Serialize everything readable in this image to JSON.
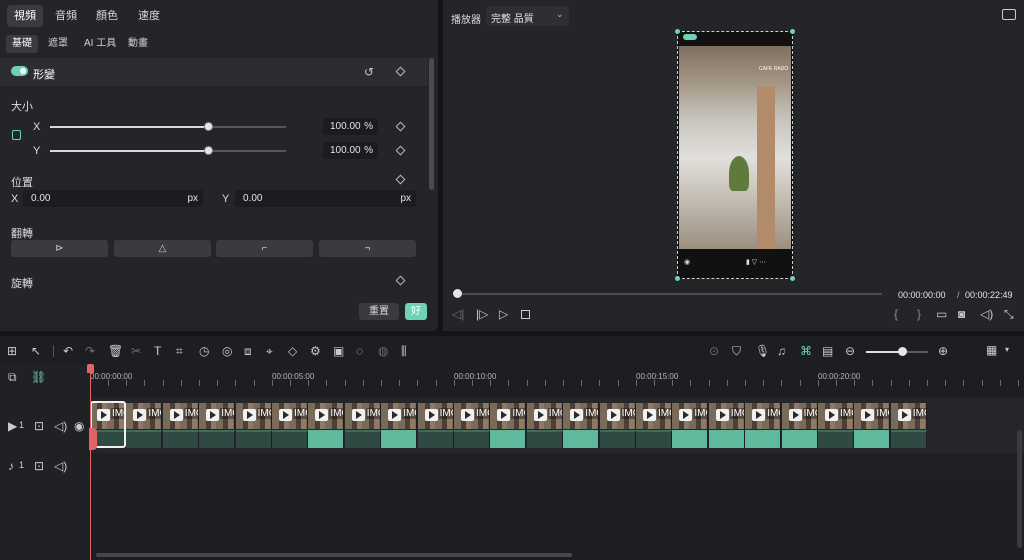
{
  "tabs": [
    "視頻",
    "音頻",
    "顏色",
    "速度"
  ],
  "subtabs": [
    "基礎",
    "遮罩",
    "AI 工具",
    "動畫"
  ],
  "transform": {
    "section": "形變",
    "size_label": "大小",
    "x_label": "X",
    "y_label": "Y",
    "scale_x": "100.00",
    "scale_y": "100.00",
    "unit": "%",
    "scale_x_level": 0.67,
    "scale_y_level": 0.67
  },
  "position": {
    "label": "位置",
    "x_label": "X",
    "x_value": "0.00",
    "y_label": "Y",
    "y_value": "0.00",
    "unit": "px"
  },
  "flip": {
    "label": "翻轉"
  },
  "rotate": {
    "label": "旋轉"
  },
  "buttons": {
    "reset": "重置",
    "ok": "好"
  },
  "player": {
    "label": "播放器",
    "quality": "完整 品質",
    "current": "00:00:00:00",
    "separator": "/",
    "total": "00:00:22:49",
    "progress": 0.0
  },
  "preview": {
    "badge": "CAFE RADO"
  },
  "ruler": [
    "00:00:00:00",
    "00:00:05:00",
    "00:00:10:00",
    "00:00:15:00",
    "00:00:20:00"
  ],
  "tracks": {
    "video": "1",
    "audio": "1"
  },
  "clip_label": "IMG",
  "colors": {
    "accent": "#6fd3b3",
    "playhead": "#e36464",
    "panel": "#242529"
  }
}
